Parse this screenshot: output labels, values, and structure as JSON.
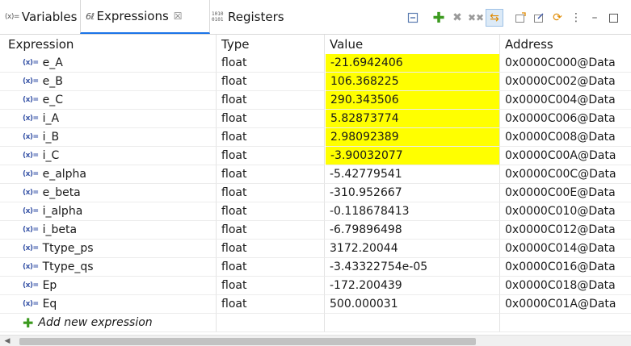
{
  "tabs": {
    "variables": {
      "glyph": "(x)=",
      "label": "Variables"
    },
    "expressions": {
      "glyph": "6ℓ",
      "label": "Expressions",
      "close": "☒"
    },
    "registers": {
      "glyph_top": "1010",
      "glyph_bottom": "0101",
      "label": "Registers"
    }
  },
  "toolbar": {
    "icons": [
      "collapse-all-icon",
      "add-icon",
      "remove-icon",
      "remove-all-icon",
      "link-icon",
      "new-window-icon",
      "export-icon",
      "refresh-icon",
      "view-menu-icon",
      "minimize-icon",
      "maximize-icon"
    ]
  },
  "table": {
    "headers": {
      "expression": "Expression",
      "type": "Type",
      "value": "Value",
      "address": "Address"
    },
    "var_glyph": "(x)=",
    "rows": [
      {
        "name": "e_A",
        "type": "float",
        "value": "-21.6942406",
        "address": "0x0000C000@Data",
        "changed": true
      },
      {
        "name": "e_B",
        "type": "float",
        "value": "106.368225",
        "address": "0x0000C002@Data",
        "changed": true
      },
      {
        "name": "e_C",
        "type": "float",
        "value": "290.343506",
        "address": "0x0000C004@Data",
        "changed": true
      },
      {
        "name": "i_A",
        "type": "float",
        "value": "5.82873774",
        "address": "0x0000C006@Data",
        "changed": true
      },
      {
        "name": "i_B",
        "type": "float",
        "value": "2.98092389",
        "address": "0x0000C008@Data",
        "changed": true
      },
      {
        "name": "i_C",
        "type": "float",
        "value": "-3.90032077",
        "address": "0x0000C00A@Data",
        "changed": true
      },
      {
        "name": "e_alpha",
        "type": "float",
        "value": "-5.42779541",
        "address": "0x0000C00C@Data",
        "changed": false
      },
      {
        "name": "e_beta",
        "type": "float",
        "value": "-310.952667",
        "address": "0x0000C00E@Data",
        "changed": false
      },
      {
        "name": "i_alpha",
        "type": "float",
        "value": "-0.118678413",
        "address": "0x0000C010@Data",
        "changed": false
      },
      {
        "name": "i_beta",
        "type": "float",
        "value": "-6.79896498",
        "address": "0x0000C012@Data",
        "changed": false
      },
      {
        "name": "Ttype_ps",
        "type": "float",
        "value": "3172.20044",
        "address": "0x0000C014@Data",
        "changed": false
      },
      {
        "name": "Ttype_qs",
        "type": "float",
        "value": "-3.43322754e-05",
        "address": "0x0000C016@Data",
        "changed": false
      },
      {
        "name": "Ep",
        "type": "float",
        "value": "-172.200439",
        "address": "0x0000C018@Data",
        "changed": false
      },
      {
        "name": "Eq",
        "type": "float",
        "value": "500.000031",
        "address": "0x0000C01A@Data",
        "changed": false
      }
    ],
    "add_new_label": "Add new expression"
  },
  "colors": {
    "changed_value_highlight": "#ffff00",
    "active_tab_accent": "#1a73e8",
    "add_icon": "#3c9a1f"
  }
}
